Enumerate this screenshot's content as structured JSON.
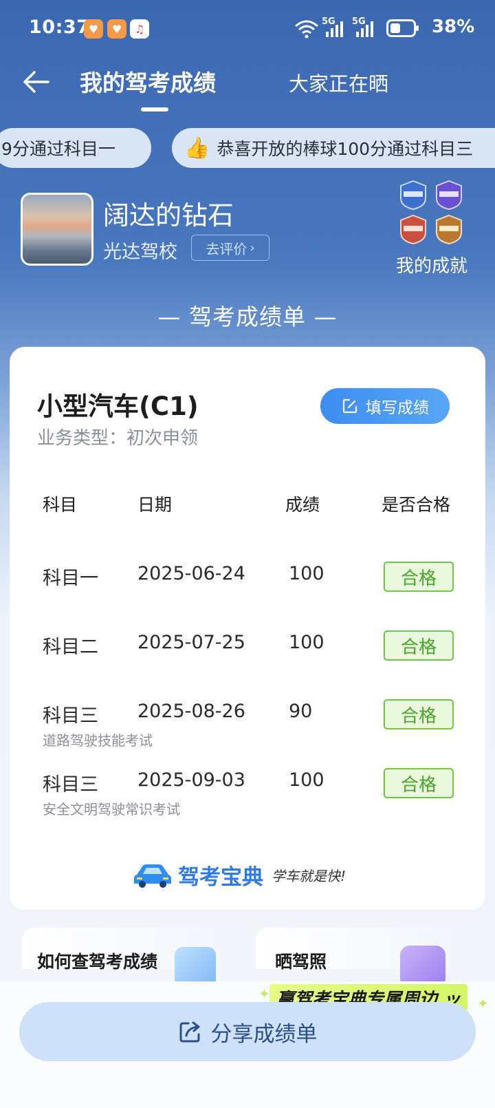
{
  "status_bar": {
    "time": "10:37",
    "network_1": "5G",
    "network_2": "5G",
    "battery": "38%",
    "app_icons": [
      "heart-app-icon",
      "heart-app-icon",
      "music-app-icon"
    ]
  },
  "header": {
    "active_tab": "我的驾考成绩",
    "other_tab": "大家正在晒"
  },
  "ticker": {
    "items": [
      "9分通过科目一",
      "恭喜开放的棒球100分通过科目三"
    ]
  },
  "profile": {
    "name": "阔达的钻石",
    "school": "光达驾校",
    "rate_button": "去评价",
    "achievements_label": "我的成就"
  },
  "sheet_title": "— 驾考成绩单 —",
  "card": {
    "vehicle_type": "小型汽车(C1)",
    "business_type": "业务类型：初次申领",
    "fill_button": "填写成绩",
    "columns": [
      "科目",
      "日期",
      "成绩",
      "是否合格"
    ],
    "rows": [
      {
        "subject": "科目一",
        "date": "2025-06-24",
        "score": "100",
        "result": "合格",
        "note": ""
      },
      {
        "subject": "科目二",
        "date": "2025-07-25",
        "score": "100",
        "result": "合格",
        "note": ""
      },
      {
        "subject": "科目三",
        "date": "2025-08-26",
        "score": "90",
        "result": "合格",
        "note": "道路驾驶技能考试"
      },
      {
        "subject": "科目三",
        "date": "2025-09-03",
        "score": "100",
        "result": "合格",
        "note": "安全文明驾驶常识考试"
      }
    ],
    "brand_name": "驾考宝典",
    "brand_slogan": "学车就是快!"
  },
  "panels": {
    "left_title": "如何查驾考成绩",
    "right_title": "晒驾照"
  },
  "promo_banner": "赢驾考宝典专属周边",
  "share_button": "分享成绩单",
  "colors": {
    "header_blue": "#3b67b0",
    "accent_blue": "#3d8df0",
    "pass_green": "#4aa52c",
    "share_bg": "#cfe0fb"
  }
}
